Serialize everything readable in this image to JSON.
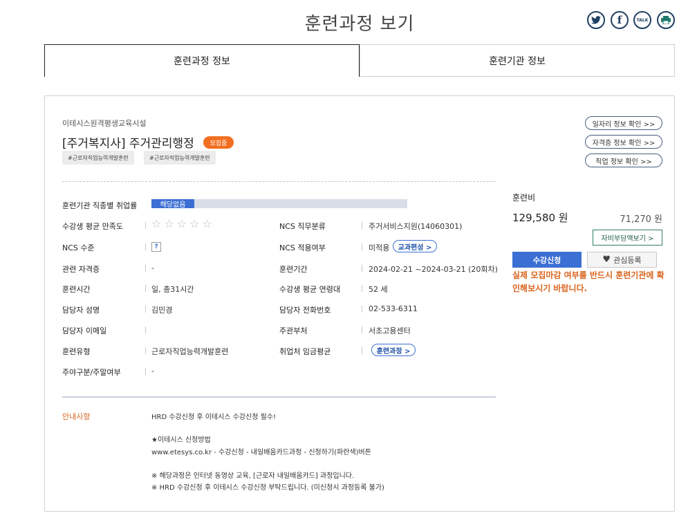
{
  "page": {
    "title": "훈련과정 보기"
  },
  "share": {
    "twitter": "t",
    "facebook": "f",
    "talk": "TALK",
    "print": "▤"
  },
  "tabs": [
    {
      "label": "훈련과정 정보"
    },
    {
      "label": "훈련기관 정보"
    }
  ],
  "course": {
    "org": "이테시스원격평생교육시설",
    "title": "[주거복지사] 주거관리행정",
    "status_badge": "모집중",
    "tags": [
      "#근로자직업능력개발훈련",
      "#근로자직업능력개발훈련"
    ]
  },
  "links": {
    "job_info": "일자리 정보 확인 >>",
    "cert_info": "자격증 정보 확인 >>",
    "career_info": "직업 정보 확인 >>"
  },
  "details": {
    "employment_rate_label": "훈련기관 직종별 취업률",
    "employment_rate_value": "해당없음",
    "satisfaction_label": "수강생 평균 만족도",
    "satisfaction_stars": 0,
    "ncs_level_label": "NCS 수준",
    "ncs_level_icon": "?",
    "related_cert_label": "관련 자격증",
    "related_cert_value": "-",
    "training_hours_label": "훈련시간",
    "training_hours_value": "일, 총31시간",
    "manager_name_label": "담당자 성명",
    "manager_name_value": "김민경",
    "manager_email_label": "담당자 이메일",
    "manager_email_value": "",
    "training_type_label": "훈련유형",
    "training_type_value": "근로자직업능력개발훈련",
    "day_type_label": "주야구분/주말여부",
    "day_type_value": "-",
    "ncs_job_label": "NCS 직무분류",
    "ncs_job_value": "주거서비스지원(14060301)",
    "ncs_apply_label": "NCS 적용여부",
    "ncs_apply_value": "미적용",
    "curriculum_button": "교과편성 >",
    "period_label": "훈련기간",
    "period_value": "2024-02-21 ~2024-03-21 (20회차)",
    "avg_age_label": "수강생 평균 연령대",
    "avg_age_value": "52 세",
    "manager_phone_label": "담당자 전화번호",
    "manager_phone_value": "02-533-6311",
    "ministry_label": "주관부처",
    "ministry_value": "서초고용센터",
    "wage_label": "취업처 임금평균",
    "course_button": "훈련과정 >"
  },
  "notice": {
    "label": "안내사항",
    "lines": [
      "HRD 수강신청 후 이테시스 수강신청 필수!",
      "★이테시스 신청방법",
      "www.etesys.co.kr - 수강신청 - 내일배움카드과정 - 신청하기(파란색)버튼",
      "※ 해당과정은 인터넷 동영상 교육, [근로자 내일배움카드] 과정입니다.",
      "※ HRD 수강신청 후 이테시스 수강신청 부탁드립니다. (미신청시 과정등록 불가)"
    ]
  },
  "fee": {
    "label": "훈련비",
    "amount": "129,580 원",
    "self_pay": "71,270 원",
    "self_pay_button": "자비부담액보기 >",
    "apply_button": "수강신청",
    "interest_button": "관심등록",
    "warning": "실제 모집마감 여부를 반드시 훈련기관에 확인해보시기 바랍니다."
  },
  "colors": {
    "accent": "#3b6fd4",
    "orange": "#f26f21",
    "notice": "#d9641d",
    "navy": "#1f3f63"
  }
}
